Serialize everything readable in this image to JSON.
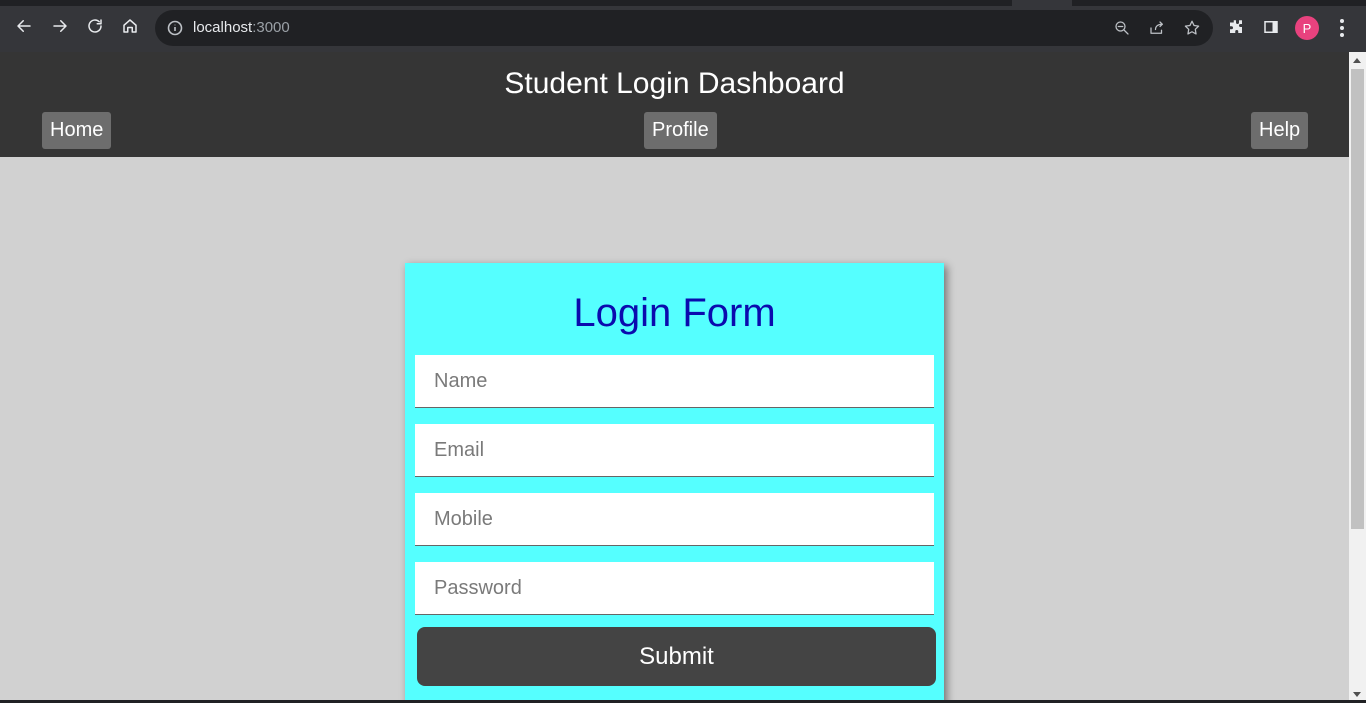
{
  "browser": {
    "url_host": "localhost",
    "url_port": ":3000",
    "avatar_letter": "P"
  },
  "page": {
    "title": "Student Login Dashboard",
    "nav": {
      "home": "Home",
      "profile": "Profile",
      "help": "Help"
    }
  },
  "login": {
    "title": "Login Form",
    "fields": {
      "name_placeholder": "Name",
      "email_placeholder": "Email",
      "mobile_placeholder": "Mobile",
      "password_placeholder": "Password"
    },
    "submit_label": "Submit"
  },
  "colors": {
    "header_bg": "#353535",
    "page_bg": "#d1d1d1",
    "card_bg": "#55ffff",
    "title_color": "#0b0bae",
    "button_bg": "#444444",
    "nav_button_bg": "#6d6d6d"
  }
}
